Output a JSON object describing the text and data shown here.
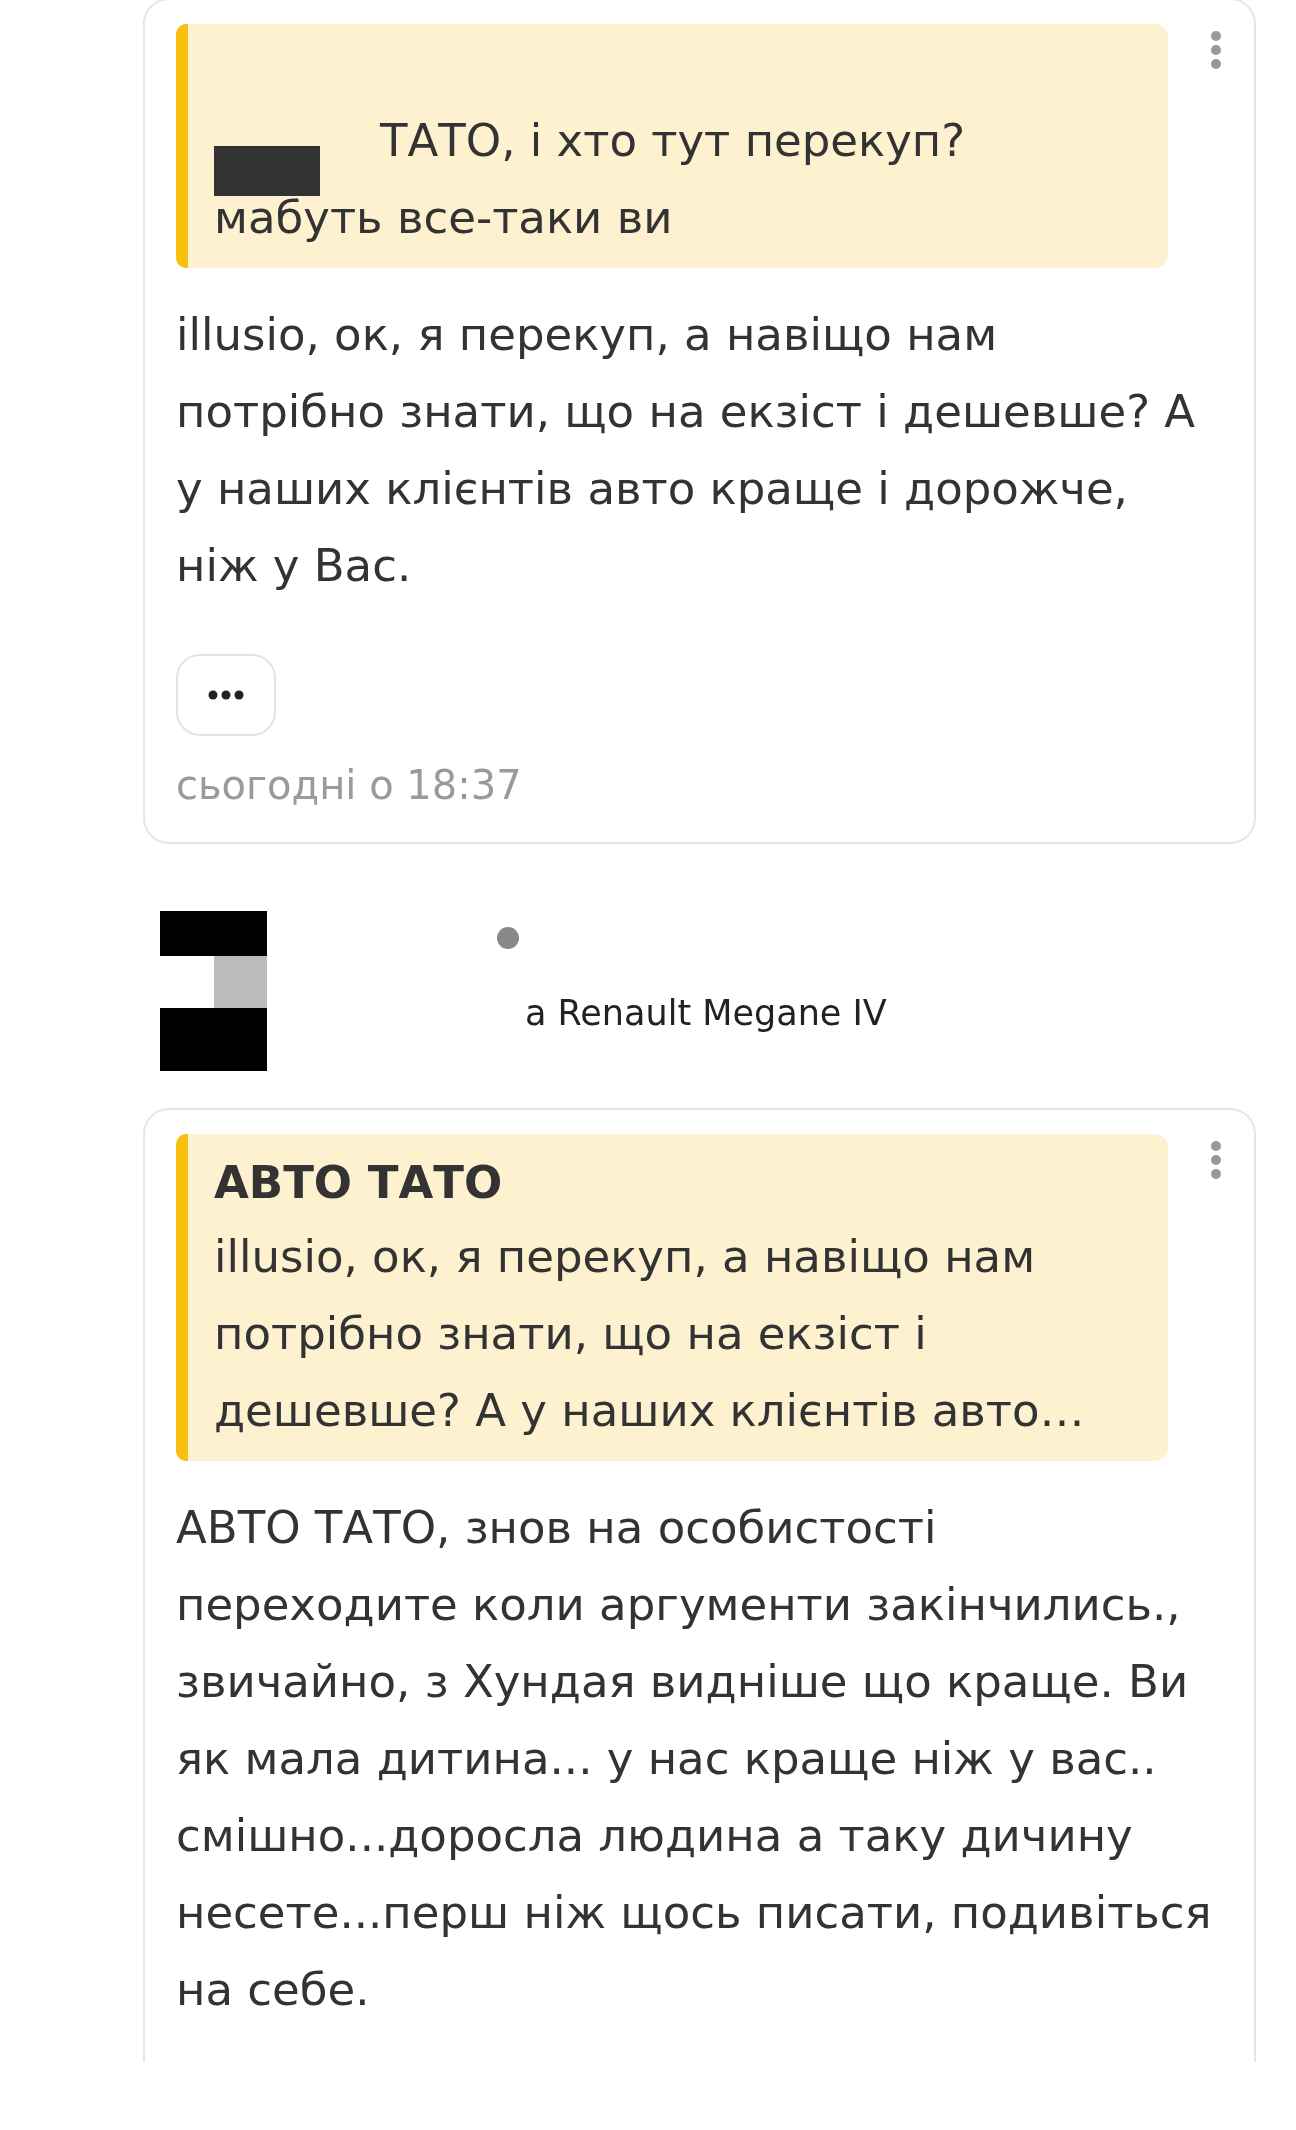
{
  "comments": [
    {
      "quote": {
        "redacted": true,
        "text": "ТАТО, і хто тут перекуп? мабуть все-таки ви"
      },
      "body": "illusio, ок, я перекуп, а навіщо нам потрібно знати, що на екзіст і дешевше? А у наших клієнтів авто краще і дорожче, ніж у Вас.",
      "more_button": true,
      "timestamp": "сьогодні о 18:37"
    },
    {
      "header": {
        "avatar_redacted": true,
        "subtitle": "а Renault Megane IV"
      },
      "quote": {
        "author": "АВТО ТАТО",
        "text": "illusio, ок, я перекуп, а навіщо нам потрібно знати, що на екзіст і дешевше? А у наших клієнтів авто…"
      },
      "body": "АВТО ТАТО, знов на особистості переходите коли аргументи закінчились., звичайно, з Хундая видніше що краще. Ви як мала дитина... у нас краще ніж у вас.. смішно...доросла людина а таку дичину несете...перш ніж щось писати, подивіться на себе."
    }
  ]
}
